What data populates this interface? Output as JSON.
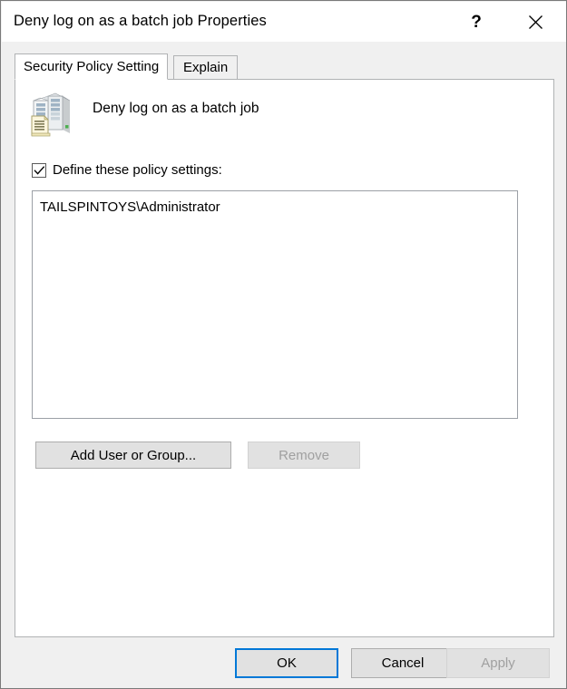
{
  "window": {
    "title": "Deny log on as a batch job Properties",
    "help_icon": "question-mark-icon",
    "close_icon": "close-icon"
  },
  "tabs": [
    {
      "label": "Security Policy Setting",
      "selected": true
    },
    {
      "label": "Explain",
      "selected": false
    }
  ],
  "policy": {
    "icon": "server-policy-icon",
    "name": "Deny log on as a batch job"
  },
  "define_setting": {
    "label": "Define these policy settings:",
    "checked": true
  },
  "principals": {
    "items": [
      {
        "name": "TAILSPINTOYS\\Administrator"
      }
    ]
  },
  "list_buttons": {
    "add": {
      "label": "Add User or Group...",
      "enabled": true
    },
    "remove": {
      "label": "Remove",
      "enabled": false
    }
  },
  "command_buttons": {
    "ok": {
      "label": "OK",
      "enabled": true,
      "default": true
    },
    "cancel": {
      "label": "Cancel",
      "enabled": true
    },
    "apply": {
      "label": "Apply",
      "enabled": false
    }
  },
  "colors": {
    "dialog_background": "#f0f0f0",
    "panel_background": "#ffffff",
    "focus_accent": "#0078d7",
    "button_face": "#e1e1e1",
    "button_border": "#adadad",
    "disabled_text": "#a0a0a0",
    "frame_border": "#7a7a7a"
  }
}
